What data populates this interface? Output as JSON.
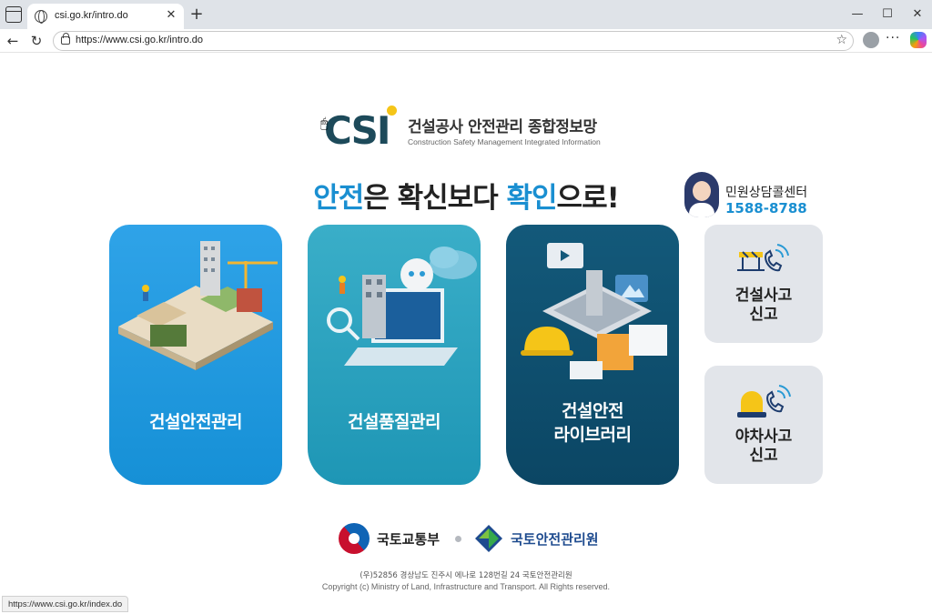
{
  "browser": {
    "tab_title": "csi.go.kr/intro.do",
    "url": "https://www.csi.go.kr/intro.do",
    "status_url": "https://www.csi.go.kr/index.do"
  },
  "header": {
    "logo_mark": "CSI",
    "logo_korean": "건설공사 안전관리 종합정보망",
    "logo_english": "Construction Safety Management Integrated Information"
  },
  "slogan": {
    "part1": "안전",
    "part2": "은 확신보다 ",
    "part3": "확인",
    "part4": "으로!"
  },
  "call_center": {
    "title": "민원상담콜센터",
    "number": "1588-8788"
  },
  "cards": [
    {
      "label": "건설안전관리"
    },
    {
      "label": "건설품질관리"
    },
    {
      "label_line1": "건설안전",
      "label_line2": "라이브러리"
    }
  ],
  "side_buttons": [
    {
      "line1": "건설사고",
      "line2": "신고",
      "icon": "construction-phone-icon"
    },
    {
      "line1": "야차사고",
      "line2": "신고",
      "icon": "siren-phone-icon"
    }
  ],
  "footer": {
    "org1": "국토교통부",
    "org2": "국토안전관리원",
    "address": "(우)52856 경상남도 진주시 에나로 128번길 24 국토안전관리원",
    "copyright": "Copyright (c) Ministry of Land, Infrastructure and Transport. All Rights reserved."
  },
  "colors": {
    "accent_blue": "#1a8fd1",
    "card1": "#1690d6",
    "card2": "#1e96b5",
    "card3": "#0b4664",
    "side_bg": "#e2e5ea"
  }
}
